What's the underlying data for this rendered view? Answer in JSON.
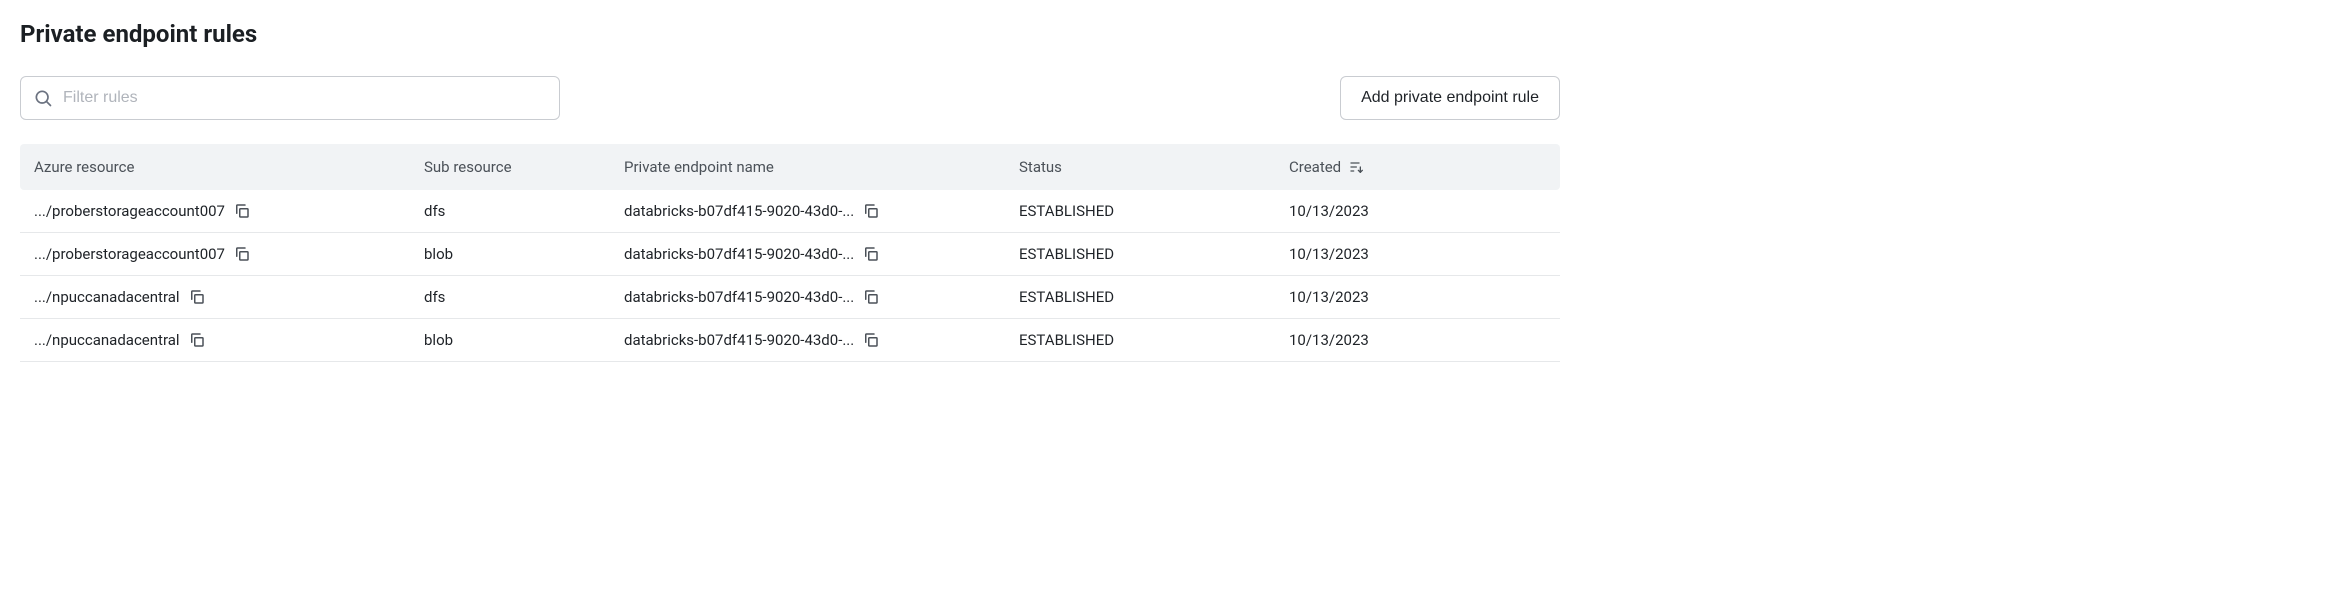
{
  "header": {
    "title": "Private endpoint rules"
  },
  "toolbar": {
    "filter_placeholder": "Filter rules",
    "filter_value": "",
    "add_button_label": "Add private endpoint rule"
  },
  "columns": {
    "azure_resource": "Azure resource",
    "sub_resource": "Sub resource",
    "pe_name": "Private endpoint name",
    "status": "Status",
    "created": "Created"
  },
  "rows": [
    {
      "azure_resource": ".../proberstorageaccount007",
      "sub_resource": "dfs",
      "pe_name": "databricks-b07df415-9020-43d0-...",
      "status": "ESTABLISHED",
      "created": "10/13/2023"
    },
    {
      "azure_resource": ".../proberstorageaccount007",
      "sub_resource": "blob",
      "pe_name": "databricks-b07df415-9020-43d0-...",
      "status": "ESTABLISHED",
      "created": "10/13/2023"
    },
    {
      "azure_resource": ".../npuccanadacentral",
      "sub_resource": "dfs",
      "pe_name": "databricks-b07df415-9020-43d0-...",
      "status": "ESTABLISHED",
      "created": "10/13/2023"
    },
    {
      "azure_resource": ".../npuccanadacentral",
      "sub_resource": "blob",
      "pe_name": "databricks-b07df415-9020-43d0-...",
      "status": "ESTABLISHED",
      "created": "10/13/2023"
    }
  ]
}
